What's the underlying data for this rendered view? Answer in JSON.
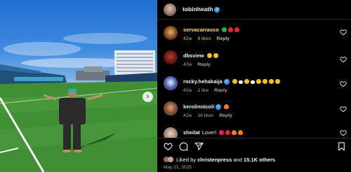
{
  "post": {
    "author": "tobinheath",
    "date": "May 21, 2025"
  },
  "comments": [
    {
      "user": "servacarrasco",
      "text": "",
      "time": "42w",
      "likes": "8 likes",
      "reply": "Reply",
      "emojis": [
        "green-circle",
        "red-heart",
        "red-heart"
      ]
    },
    {
      "user": "dbsview",
      "text": "",
      "time": "42w",
      "likes": "",
      "reply": "Reply",
      "emojis": [
        "clap",
        "clap"
      ]
    },
    {
      "user": "rocky.hehakaija",
      "text": "",
      "time": "42w",
      "likes": "1 like",
      "reply": "Reply",
      "emojis": [
        "verified",
        "wow-face",
        "dash",
        "wow-face",
        "dash",
        "wow-face",
        "muscle",
        "muscle",
        "muscle"
      ]
    },
    {
      "user": "kerolinnicoli",
      "text": "",
      "time": "42w",
      "likes": "16 likes",
      "reply": "Reply",
      "emojis": [
        "verified",
        "fire"
      ]
    },
    {
      "user": "sheilat",
      "text": "Love!!",
      "time": "",
      "likes": "",
      "reply": "",
      "emojis": [
        "red-heart",
        "red-heart",
        "fire",
        "fire"
      ]
    }
  ],
  "likes": {
    "prefix": "Liked by",
    "first": "christenpress",
    "joiner": "and",
    "others": "15.1K others"
  },
  "icons": {
    "heart": "heart-icon",
    "comment": "comment-icon",
    "share": "share-icon",
    "save": "bookmark-icon",
    "next": "chevron-right-icon",
    "verified": "verified-badge-icon"
  },
  "colors": {
    "background": "#000000",
    "verified": "#3897f0",
    "muted": "#a8a8a8"
  }
}
